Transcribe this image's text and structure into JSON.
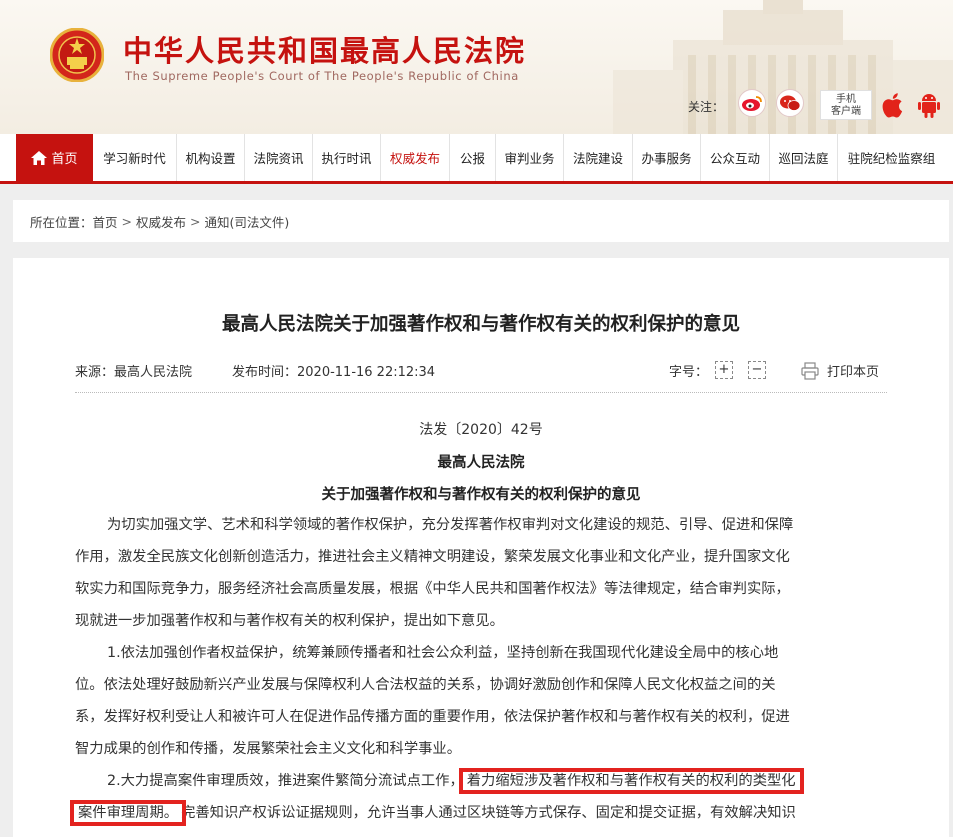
{
  "header": {
    "title_cn": "中华人民共和国最高人民法院",
    "title_en": "The Supreme People's Court of The People's Republic of China",
    "follow_label": "关注：",
    "client_label_line1": "手机",
    "client_label_line2": "客户端",
    "icons": [
      "emblem-icon",
      "weibo-icon",
      "wechat-icon",
      "apple-icon",
      "android-icon"
    ],
    "brand_color": "#c5120f"
  },
  "nav": {
    "home": "首页",
    "items": [
      "学习新时代",
      "机构设置",
      "法院资讯",
      "执行时讯",
      "权威发布",
      "公报",
      "审判业务",
      "法院建设",
      "办事服务",
      "公众互动",
      "巡回法庭",
      "驻院纪检监察组"
    ],
    "active": "权威发布"
  },
  "breadcrumb": {
    "label": "所在位置：",
    "items": [
      "首页",
      "权威发布",
      "通知(司法文件)"
    ],
    "separator": ">"
  },
  "article": {
    "title": "最高人民法院关于加强著作权和与著作权有关的权利保护的意见",
    "source": "来源：最高人民法院",
    "published": "发布时间：2020-11-16 22:12:34",
    "font_size_label": "字号：",
    "font_plus": "+",
    "font_minus": "−",
    "print_label": "打印本页",
    "doc_number": "法发〔2020〕42号",
    "issuer": "最高人民法院",
    "subtitle": "关于加强著作权和与著作权有关的权利保护的意见",
    "lines": [
      "为切实加强文学、艺术和科学领域的著作权保护，充分发挥著作权审判对文化建设的规范、引导、促进和保障",
      "作用，激发全民族文化创新创造活力，推进社会主义精神文明建设，繁荣发展文化事业和文化产业，提升国家文化",
      "软实力和国际竞争力，服务经济社会高质量发展，根据《中华人民共和国著作权法》等法律规定，结合审判实际，",
      "现就进一步加强著作权和与著作权有关的权利保护，提出如下意见。",
      "1.依法加强创作者权益保护，统筹兼顾传播者和社会公众利益，坚持创新在我国现代化建设全局中的核心地",
      "位。依法处理好鼓励新兴产业发展与保障权利人合法权益的关系，协调好激励创作和保障人民文化权益之间的关",
      "系，发挥好权利受让人和被许可人在促进作品传播方面的重要作用，依法保护著作权和与著作权有关的权利，促进",
      "智力成果的创作和传播，发展繁荣社会主义文化和科学事业。"
    ],
    "line9_prefix": "2.大力提高案件审理质效，推进案件繁简分流试点工作，",
    "line9_highlight": "着力缩短涉及著作权和与著作权有关的权利的类型化",
    "line10_highlight": "案件审理周期。",
    "line10_rest": "完善知识产权诉讼证据规则，允许当事人通过区块链等方式保存、固定和提交证据，有效解决知识",
    "highlight_color": "#e3231f"
  }
}
